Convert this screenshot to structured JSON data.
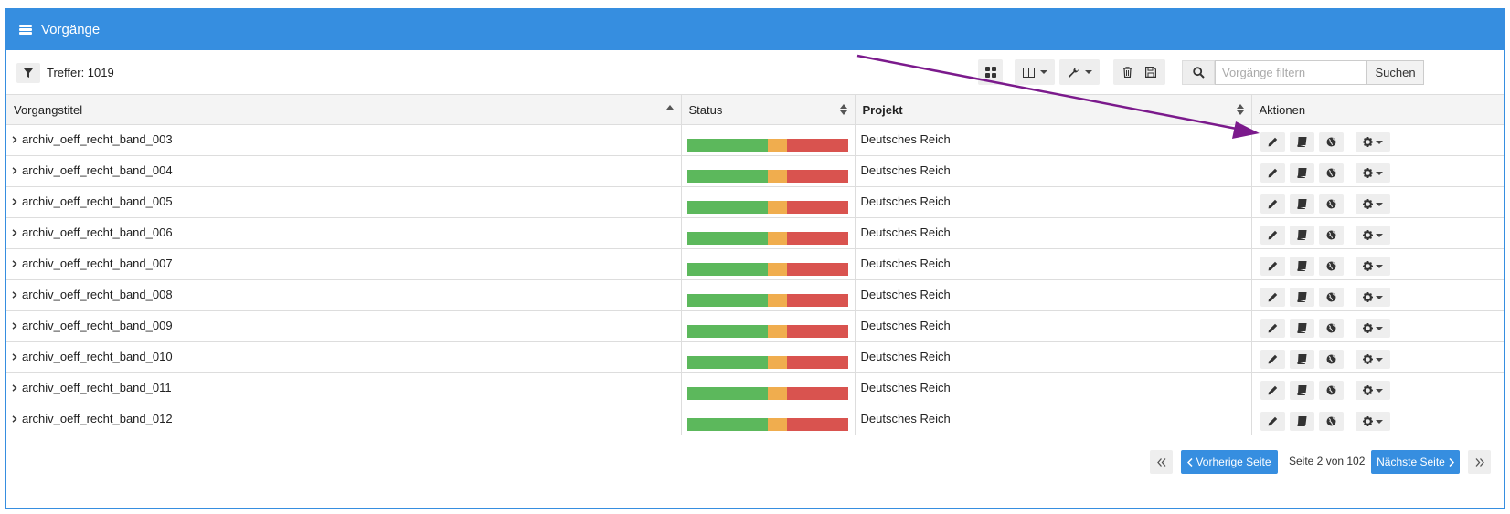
{
  "panel": {
    "title": "Vorgänge"
  },
  "toolbar": {
    "treffer": "Treffer: 1019",
    "search_placeholder": "Vorgänge filtern",
    "search_button": "Suchen"
  },
  "table": {
    "headers": {
      "title": "Vorgangstitel",
      "status": "Status",
      "project": "Projekt",
      "actions": "Aktionen"
    },
    "rows": [
      {
        "title": "archiv_oeff_recht_band_003",
        "project": "Deutsches Reich"
      },
      {
        "title": "archiv_oeff_recht_band_004",
        "project": "Deutsches Reich"
      },
      {
        "title": "archiv_oeff_recht_band_005",
        "project": "Deutsches Reich"
      },
      {
        "title": "archiv_oeff_recht_band_006",
        "project": "Deutsches Reich"
      },
      {
        "title": "archiv_oeff_recht_band_007",
        "project": "Deutsches Reich"
      },
      {
        "title": "archiv_oeff_recht_band_008",
        "project": "Deutsches Reich"
      },
      {
        "title": "archiv_oeff_recht_band_009",
        "project": "Deutsches Reich"
      },
      {
        "title": "archiv_oeff_recht_band_010",
        "project": "Deutsches Reich"
      },
      {
        "title": "archiv_oeff_recht_band_011",
        "project": "Deutsches Reich"
      },
      {
        "title": "archiv_oeff_recht_band_012",
        "project": "Deutsches Reich"
      }
    ],
    "status_split": {
      "done": 0.5,
      "in_progress": 0.12,
      "open": 0.38
    }
  },
  "pagination": {
    "prev_label": "Vorherige Seite",
    "next_label": "Nächste Seite",
    "page_info": "Seite 2 von 102"
  },
  "colors": {
    "accent": "#368ee0",
    "status_done": "#5cb85c",
    "status_in_progress": "#f0ad4e",
    "status_open": "#d9534f",
    "annotation_arrow": "#7b1a8c"
  },
  "icons": [
    "list-icon",
    "filter-icon",
    "grid-icon",
    "columns-icon",
    "wrench-icon",
    "trash-icon",
    "save-icon",
    "search-icon",
    "pencil-icon",
    "book-icon",
    "globe-icon",
    "gear-icon"
  ]
}
